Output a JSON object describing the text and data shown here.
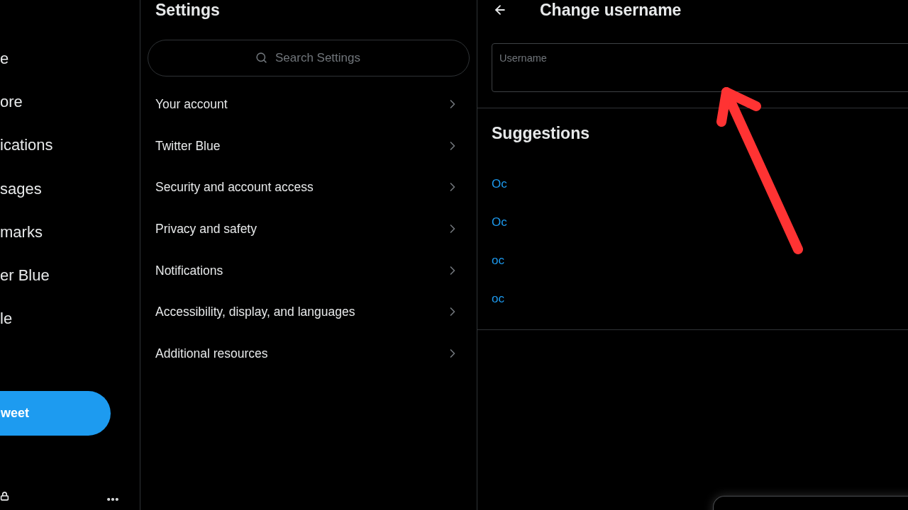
{
  "sidebar": {
    "nav_items": [
      {
        "label": "e"
      },
      {
        "label": "ore"
      },
      {
        "label": "ications"
      },
      {
        "label": "sages"
      },
      {
        "label": "marks"
      },
      {
        "label": "er Blue"
      },
      {
        "label": "le"
      }
    ],
    "tweet_button": {
      "label": "weet"
    }
  },
  "settings": {
    "title": "Settings",
    "search": {
      "placeholder": "Search Settings"
    },
    "items": [
      {
        "label": "Your account"
      },
      {
        "label": "Twitter Blue"
      },
      {
        "label": "Security and account access"
      },
      {
        "label": "Privacy and safety"
      },
      {
        "label": "Notifications"
      },
      {
        "label": "Accessibility, display, and languages"
      },
      {
        "label": "Additional resources"
      }
    ]
  },
  "change_username": {
    "title": "Change username",
    "username_field": {
      "label": "Username"
    },
    "suggestions_title": "Suggestions",
    "suggestions": [
      "Oc",
      "Oc",
      "oc",
      "oc"
    ]
  }
}
